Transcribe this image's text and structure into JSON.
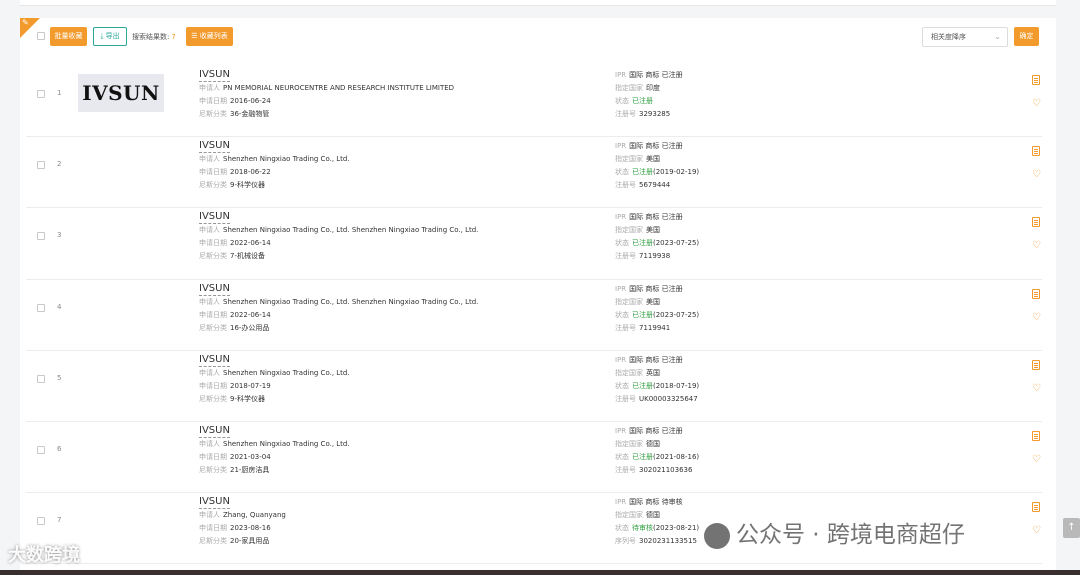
{
  "toolbar": {
    "batch_favorite": "批量收藏",
    "export": "导出",
    "result_label": "搜索结果数:",
    "result_count": "7",
    "favorite_list": "收藏列表",
    "sort_selected": "相关度降序",
    "confirm": "确定"
  },
  "labels": {
    "applicant": "申请人",
    "app_date": "申请日期",
    "nice_class": "尼斯分类",
    "ipr": "IPR",
    "country": "指定国家",
    "status": "状态",
    "reg_no": "注册号",
    "serial_no": "序列号"
  },
  "results": [
    {
      "index": "1",
      "logo_text": "IVSUN",
      "name": "IVSUN",
      "applicant": "PN MEMORIAL NEUROCENTRE AND RESEARCH INSTITUTE LIMITED",
      "app_date": "2016-06-24",
      "nice_class": "36-金融物管",
      "ipr": "国际 商标 已注册",
      "country": "印度",
      "status": "已注册",
      "status_date": "",
      "reg_no": "3293285"
    },
    {
      "index": "2",
      "logo_text": "",
      "name": "IVSUN",
      "applicant": "Shenzhen Ningxiao Trading Co., Ltd.",
      "app_date": "2018-06-22",
      "nice_class": "9-科学仪器",
      "ipr": "国际 商标 已注册",
      "country": "美国",
      "status": "已注册",
      "status_date": "(2019-02-19)",
      "reg_no": "5679444"
    },
    {
      "index": "3",
      "logo_text": "",
      "name": "IVSUN",
      "applicant": "Shenzhen Ningxiao Trading Co., Ltd.  Shenzhen Ningxiao Trading Co., Ltd.",
      "app_date": "2022-06-14",
      "nice_class": "7-机械设备",
      "ipr": "国际 商标 已注册",
      "country": "美国",
      "status": "已注册",
      "status_date": "(2023-07-25)",
      "reg_no": "7119938"
    },
    {
      "index": "4",
      "logo_text": "",
      "name": "IVSUN",
      "applicant": "Shenzhen Ningxiao Trading Co., Ltd.  Shenzhen Ningxiao Trading Co., Ltd.",
      "app_date": "2022-06-14",
      "nice_class": "16-办公用品",
      "ipr": "国际 商标 已注册",
      "country": "美国",
      "status": "已注册",
      "status_date": "(2023-07-25)",
      "reg_no": "7119941"
    },
    {
      "index": "5",
      "logo_text": "",
      "name": "IVSUN",
      "applicant": "Shenzhen Ningxiao Trading Co., Ltd.",
      "app_date": "2018-07-19",
      "nice_class": "9-科学仪器",
      "ipr": "国际 商标 已注册",
      "country": "英国",
      "status": "已注册",
      "status_date": "(2018-07-19)",
      "reg_no": "UK00003325647"
    },
    {
      "index": "6",
      "logo_text": "",
      "name": "IVSUN",
      "applicant": "Shenzhen Ningxiao Trading Co., Ltd.",
      "app_date": "2021-03-04",
      "nice_class": "21-厨房洁具",
      "ipr": "国际 商标 已注册",
      "country": "德国",
      "status": "已注册",
      "status_date": "(2021-08-16)",
      "reg_no": "302021103636"
    },
    {
      "index": "7",
      "logo_text": "",
      "name": "IVSUN",
      "applicant": "Zhang, Quanyang",
      "app_date": "2023-08-16",
      "nice_class": "20-家具用品",
      "ipr": "国际 商标 待审核",
      "country": "德国",
      "status": "待审核",
      "status_date": "(2023-08-21)",
      "reg_no": "3020231133515",
      "reg_label_key": "serial"
    }
  ],
  "watermarks": {
    "left": "大数跨境",
    "right": "公众号 · 跨境电商超仔"
  },
  "icons": {
    "corner": "pin-icon",
    "export": "download-icon",
    "favorite_list": "list-icon",
    "row_doc": "document-icon",
    "row_fav": "heart-icon",
    "scroll_top": "arrow-up-icon"
  },
  "colors": {
    "accent": "#f39a2c",
    "teal": "#2aa99a",
    "status_green": "#2e9e3e"
  }
}
